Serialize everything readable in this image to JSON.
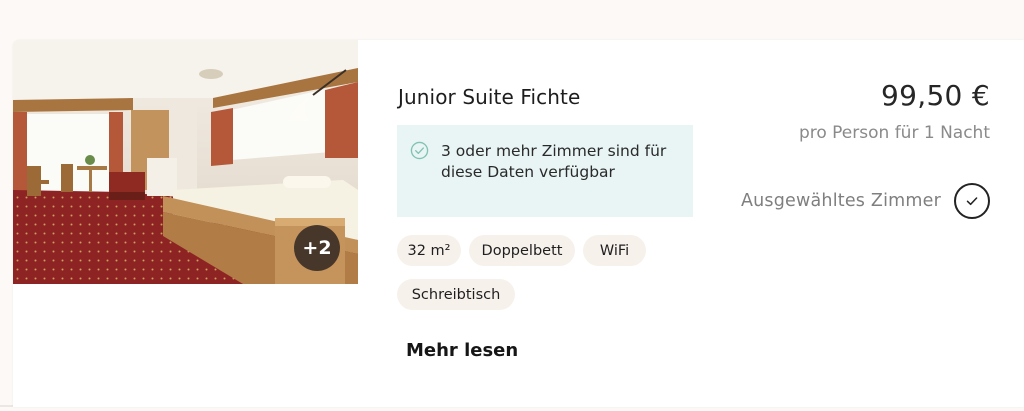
{
  "room": {
    "title": "Junior Suite Fichte",
    "photo": {
      "extra_count_label": "+2"
    },
    "availability": {
      "icon": "check-circle-icon",
      "text": "3 oder mehr Zimmer sind für diese Daten verfügbar"
    },
    "amenities": [
      "32 m²",
      "Doppelbett",
      "WiFi",
      "Schreibtisch"
    ],
    "read_more_label": "Mehr lesen"
  },
  "pricing": {
    "price": "99,50 €",
    "note": "pro Person für 1 Nacht"
  },
  "selection": {
    "label": "Ausgewähltes Zimmer",
    "icon": "checkmark-icon"
  },
  "colors": {
    "availability_bg": "#e9f4f4",
    "availability_icon": "#7fc3b2",
    "chip_bg": "#f7f1ec",
    "page_bg": "#fdf9f6"
  }
}
